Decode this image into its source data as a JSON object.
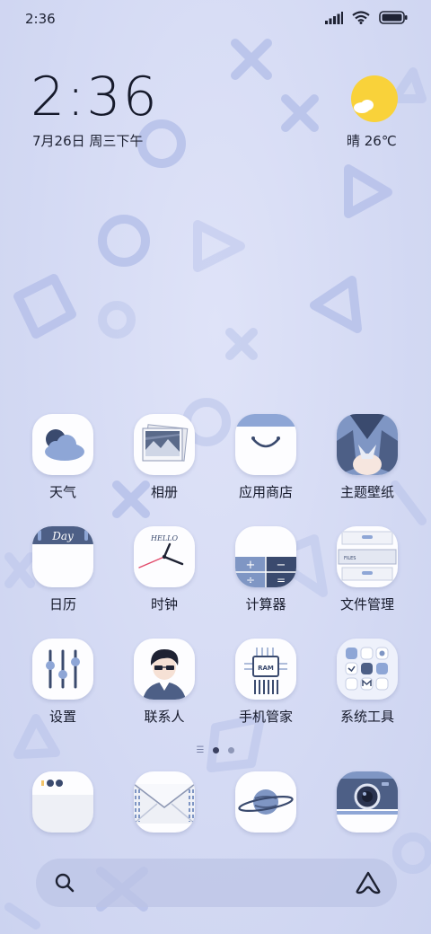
{
  "status": {
    "time": "2:36"
  },
  "clock": {
    "time": "2:36",
    "date": "7月26日 周三下午"
  },
  "weather": {
    "text": "晴 26℃"
  },
  "apps": [
    {
      "label": "天气",
      "icon": "weather-cloud-icon"
    },
    {
      "label": "相册",
      "icon": "gallery-photo-icon"
    },
    {
      "label": "应用商店",
      "icon": "app-store-bag-icon"
    },
    {
      "label": "主题壁纸",
      "icon": "themes-character-icon"
    },
    {
      "label": "日历",
      "icon": "calendar-icon"
    },
    {
      "label": "时钟",
      "icon": "clock-icon"
    },
    {
      "label": "计算器",
      "icon": "calculator-icon"
    },
    {
      "label": "文件管理",
      "icon": "file-cabinet-icon"
    },
    {
      "label": "设置",
      "icon": "settings-sliders-icon"
    },
    {
      "label": "联系人",
      "icon": "contacts-avatar-icon"
    },
    {
      "label": "手机管家",
      "icon": "security-chip-icon"
    },
    {
      "label": "系统工具",
      "icon": "system-tools-folder-icon"
    }
  ],
  "calendar_icon_text": "Day",
  "clock_icon_text": "HELLO",
  "files_icon_text": "FILES",
  "ram_icon_text": "RAM",
  "calc_symbols": {
    "plus": "+",
    "minus": "−",
    "div": "÷",
    "eq": "="
  },
  "pager": {
    "pages": 2,
    "active": 1
  },
  "dock": [
    {
      "icon": "phone-dialer-icon"
    },
    {
      "icon": "messages-envelope-icon"
    },
    {
      "icon": "browser-planet-icon"
    },
    {
      "icon": "camera-icon"
    }
  ],
  "colors": {
    "accent": "#7f96c4",
    "sun": "#f9d23a",
    "background": "#d6dcf4"
  }
}
